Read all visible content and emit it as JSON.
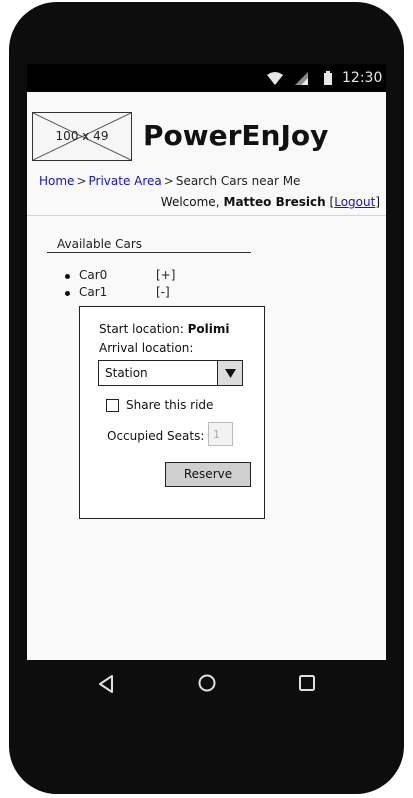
{
  "status_bar": {
    "time": "12:30",
    "icons": [
      "wifi-icon",
      "signal-icon",
      "battery-icon"
    ]
  },
  "header": {
    "logo_placeholder": "100 x 49",
    "app_title": "PowerEnJoy"
  },
  "breadcrumb": {
    "items": [
      {
        "label": "Home",
        "link": true
      },
      {
        "label": "Private Area",
        "link": true
      },
      {
        "label": "Search Cars near Me",
        "link": false
      }
    ],
    "separator": ">"
  },
  "welcome": {
    "prefix": "Welcome,",
    "user": "Matteo Bresich",
    "open_bracket": "[",
    "logout_label": "Logout",
    "close_bracket": "]"
  },
  "available_cars": {
    "title": "Available Cars",
    "cars": [
      {
        "name": "Car0",
        "toggle": "[+]"
      },
      {
        "name": "Car1",
        "toggle": "[-]"
      }
    ]
  },
  "reservation": {
    "start_label": "Start location:",
    "start_value": "Polimi",
    "arrival_label": "Arrival location:",
    "arrival_selected": "Station",
    "share_label": "Share this ride",
    "share_checked": false,
    "seats_label": "Occupied Seats:",
    "seats_value": "1",
    "reserve_label": "Reserve"
  },
  "nav_bar": {
    "buttons": [
      "back-icon",
      "home-icon",
      "recents-icon"
    ]
  },
  "colors": {
    "link": "#1515c6",
    "frame": "#0d0d0d",
    "screen": "#f9f9f9",
    "button": "#cfcfcf"
  }
}
